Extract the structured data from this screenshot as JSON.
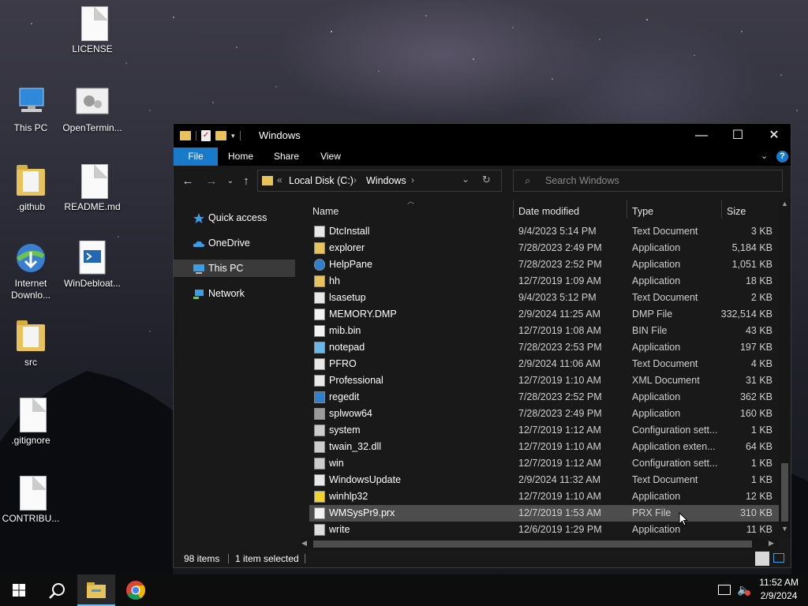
{
  "desktop": {
    "icons": [
      {
        "label": "LICENSE",
        "icon": "document-icon"
      },
      {
        "label": "This PC",
        "icon": "computer-icon"
      },
      {
        "label": "OpenTermin...",
        "icon": "gears-document-icon"
      },
      {
        "label": ".github",
        "icon": "folder-icon"
      },
      {
        "label": "README.md",
        "icon": "document-icon"
      },
      {
        "label": "Internet Downlo...",
        "icon": "download-manager-icon"
      },
      {
        "label": "WinDebloat...",
        "icon": "powershell-script-icon"
      },
      {
        "label": "src",
        "icon": "folder-icon"
      },
      {
        "label": ".gitignore",
        "icon": "document-icon"
      },
      {
        "label": "CONTRIBU...",
        "icon": "document-icon"
      }
    ]
  },
  "window": {
    "title": "Windows",
    "controls": {
      "minimize": "—",
      "maximize": "☐",
      "close": "✕"
    },
    "ribbon_tabs": [
      "File",
      "Home",
      "Share",
      "View"
    ],
    "address": {
      "overflow": "«",
      "crumbs": [
        "Local Disk (C:)",
        "Windows"
      ],
      "separator": "›"
    },
    "search": {
      "placeholder": "Search Windows"
    },
    "nav_pane": [
      {
        "label": "Quick access",
        "icon": "star-icon",
        "selected": false
      },
      {
        "label": "OneDrive",
        "icon": "cloud-icon",
        "selected": false
      },
      {
        "label": "This PC",
        "icon": "computer-icon",
        "selected": true
      },
      {
        "label": "Network",
        "icon": "network-icon",
        "selected": false
      }
    ],
    "columns": [
      "Name",
      "Date modified",
      "Type",
      "Size"
    ],
    "files": [
      {
        "name": "DtcInstall",
        "date": "9/4/2023 5:14 PM",
        "type": "Text Document",
        "size": "3 KB",
        "icon": "text-file-icon"
      },
      {
        "name": "explorer",
        "date": "7/28/2023 2:49 PM",
        "type": "Application",
        "size": "5,184 KB",
        "icon": "explorer-app-icon"
      },
      {
        "name": "HelpPane",
        "date": "7/28/2023 2:52 PM",
        "type": "Application",
        "size": "1,051 KB",
        "icon": "help-icon"
      },
      {
        "name": "hh",
        "date": "12/7/2019 1:09 AM",
        "type": "Application",
        "size": "18 KB",
        "icon": "help-doc-icon"
      },
      {
        "name": "lsasetup",
        "date": "9/4/2023 5:12 PM",
        "type": "Text Document",
        "size": "2 KB",
        "icon": "text-file-icon"
      },
      {
        "name": "MEMORY.DMP",
        "date": "2/9/2024 11:25 AM",
        "type": "DMP File",
        "size": "332,514 KB",
        "icon": "blank-file-icon"
      },
      {
        "name": "mib.bin",
        "date": "12/7/2019 1:08 AM",
        "type": "BIN File",
        "size": "43 KB",
        "icon": "blank-file-icon"
      },
      {
        "name": "notepad",
        "date": "7/28/2023 2:53 PM",
        "type": "Application",
        "size": "197 KB",
        "icon": "notepad-icon"
      },
      {
        "name": "PFRO",
        "date": "2/9/2024 11:06 AM",
        "type": "Text Document",
        "size": "4 KB",
        "icon": "text-file-icon"
      },
      {
        "name": "Professional",
        "date": "12/7/2019 1:10 AM",
        "type": "XML Document",
        "size": "31 KB",
        "icon": "xml-file-icon"
      },
      {
        "name": "regedit",
        "date": "7/28/2023 2:52 PM",
        "type": "Application",
        "size": "362 KB",
        "icon": "registry-icon"
      },
      {
        "name": "splwow64",
        "date": "7/28/2023 2:49 PM",
        "type": "Application",
        "size": "160 KB",
        "icon": "printer-icon"
      },
      {
        "name": "system",
        "date": "12/7/2019 1:12 AM",
        "type": "Configuration sett...",
        "size": "1 KB",
        "icon": "config-file-icon"
      },
      {
        "name": "twain_32.dll",
        "date": "12/7/2019 1:10 AM",
        "type": "Application exten...",
        "size": "64 KB",
        "icon": "dll-file-icon"
      },
      {
        "name": "win",
        "date": "12/7/2019 1:12 AM",
        "type": "Configuration sett...",
        "size": "1 KB",
        "icon": "config-file-icon"
      },
      {
        "name": "WindowsUpdate",
        "date": "2/9/2024 11:32 AM",
        "type": "Text Document",
        "size": "1 KB",
        "icon": "text-file-icon"
      },
      {
        "name": "winhlp32",
        "date": "12/7/2019 1:10 AM",
        "type": "Application",
        "size": "12 KB",
        "icon": "help-question-icon"
      },
      {
        "name": "WMSysPr9.prx",
        "date": "12/7/2019 1:53 AM",
        "type": "PRX File",
        "size": "310 KB",
        "icon": "blank-file-icon",
        "selected": true
      },
      {
        "name": "write",
        "date": "12/6/2019 1:29 PM",
        "type": "Application",
        "size": "11 KB",
        "icon": "wordpad-icon"
      }
    ],
    "status": {
      "items": "98 items",
      "selected": "1 item selected"
    }
  },
  "taskbar": {
    "time": "11:52 AM",
    "date": "2/9/2024"
  },
  "colors": {
    "accent": "#1979ca",
    "window_bg": "#191919",
    "selection": "#4d4d4d",
    "folder": "#e8c25a"
  }
}
